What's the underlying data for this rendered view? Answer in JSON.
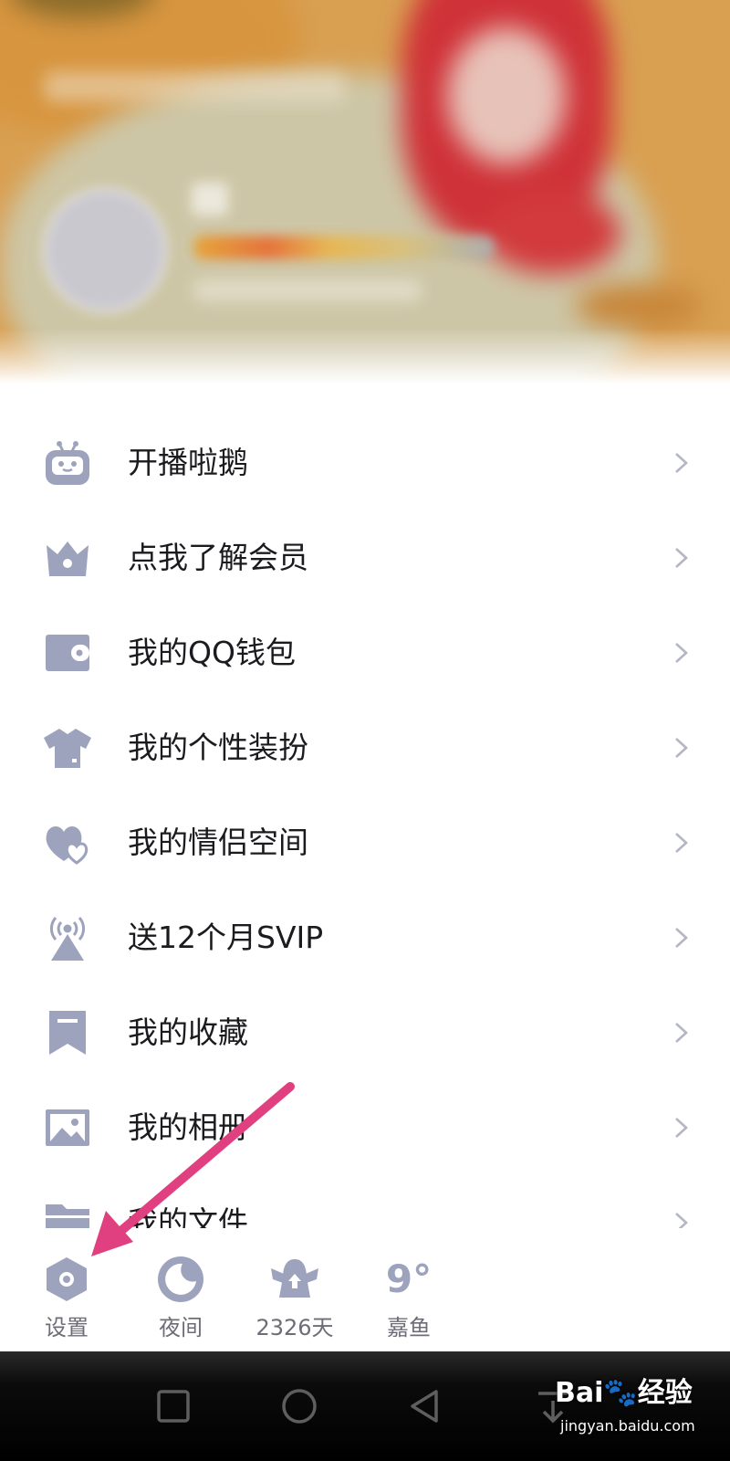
{
  "colors": {
    "icon": "#9ea3bd",
    "label": "#1b1b1f",
    "chevron": "#b4b6c4",
    "quickbar_label": "#6d6d78",
    "arrow": "#e0407f",
    "navbar": "#000000"
  },
  "menu": {
    "items": [
      {
        "label": "开播啦鹅",
        "icon": "live-robot-icon"
      },
      {
        "label": "点我了解会员",
        "icon": "crown-icon"
      },
      {
        "label": "我的QQ钱包",
        "icon": "wallet-icon"
      },
      {
        "label": "我的个性装扮",
        "icon": "tshirt-icon"
      },
      {
        "label": "我的情侣空间",
        "icon": "hearts-icon"
      },
      {
        "label": "送12个月SVIP",
        "icon": "broadcast-tower-icon"
      },
      {
        "label": "我的收藏",
        "icon": "bookmark-icon"
      },
      {
        "label": "我的相册",
        "icon": "photo-icon"
      },
      {
        "label": "我的文件",
        "icon": "folder-icon"
      }
    ]
  },
  "quickbar": {
    "settings_label": "设置",
    "night_label": "夜间",
    "days_label": "2326天",
    "weather_temp": "9°",
    "weather_city": "嘉鱼"
  },
  "watermark": {
    "brand": "Bai🐾经验",
    "url": "jingyan.baidu.com"
  }
}
